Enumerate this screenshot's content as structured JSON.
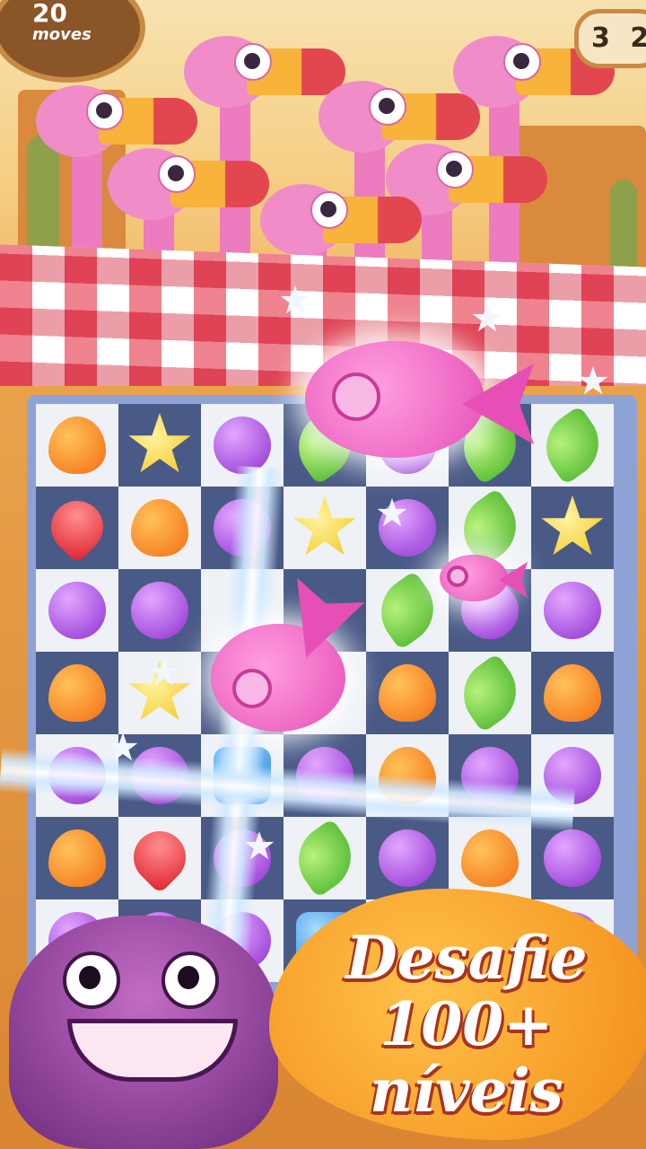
{
  "hud": {
    "moves_value": "20",
    "moves_label": "moves",
    "score": "3 2"
  },
  "promo": {
    "line1": "Desafie",
    "line2": "100+ níveis"
  },
  "board": {
    "rows": [
      [
        "orange",
        "yellow",
        "purple",
        "green",
        "purple",
        "green",
        "green"
      ],
      [
        "red",
        "orange",
        "purple",
        "yellow",
        "purple",
        "green",
        "yellow"
      ],
      [
        "purple",
        "purple",
        "empty",
        "empty",
        "green",
        "purple",
        "purple"
      ],
      [
        "orange",
        "yellow",
        "empty",
        "empty",
        "orange",
        "green",
        "orange"
      ],
      [
        "purple",
        "purple",
        "blue",
        "purple",
        "orange",
        "purple",
        "purple"
      ],
      [
        "orange",
        "red",
        "purple",
        "green",
        "purple",
        "orange",
        "purple"
      ],
      [
        "purple",
        "purple",
        "purple",
        "blue",
        "purple",
        "purple",
        "purple"
      ]
    ]
  },
  "colors": {
    "board_bg": "#8fa2d6",
    "cell_light": "#eef2f6",
    "cell_dark": "#4a5a87",
    "promo_text": "#ffffff",
    "promo_shadow": "#a8341f"
  }
}
